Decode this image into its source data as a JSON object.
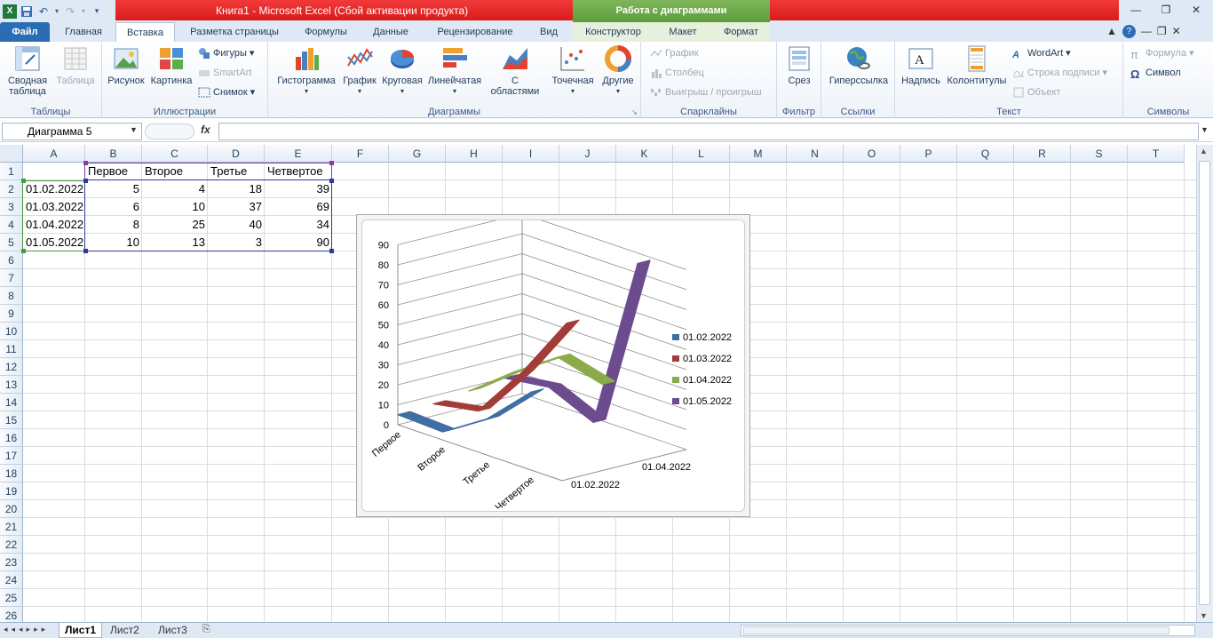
{
  "window": {
    "title": "Книга1  -  Microsoft Excel (Сбой активации продукта)",
    "context_header": "Работа с диаграммами"
  },
  "tabs": [
    "Файл",
    "Главная",
    "Вставка",
    "Разметка страницы",
    "Формулы",
    "Данные",
    "Рецензирование",
    "Вид",
    "Конструктор",
    "Макет",
    "Формат"
  ],
  "ribbon": {
    "tables": {
      "label": "Таблицы",
      "pivot": "Сводная\nтаблица",
      "table": "Таблица"
    },
    "illustrations": {
      "label": "Иллюстрации",
      "picture": "Рисунок",
      "clipart": "Картинка",
      "shapes": "Фигуры",
      "smartart": "SmartArt",
      "screenshot": "Снимок"
    },
    "charts": {
      "label": "Диаграммы",
      "column": "Гистограмма",
      "line": "График",
      "pie": "Круговая",
      "bar": "Линейчатая",
      "area": "С\nобластями",
      "scatter": "Точечная",
      "other": "Другие"
    },
    "sparklines": {
      "label": "Спарклайны",
      "line": "График",
      "column": "Столбец",
      "winloss": "Выигрыш / проигрыш"
    },
    "filter": {
      "label": "Фильтр",
      "slicer": "Срез"
    },
    "links": {
      "label": "Ссылки",
      "hyperlink": "Гиперссылка"
    },
    "text": {
      "label": "Текст",
      "textbox": "Надпись",
      "headerfooter": "Колонтитулы",
      "wordart": "WordArt",
      "signature": "Строка подписи",
      "object": "Объект"
    },
    "symbols": {
      "label": "Символы",
      "equation": "Формула",
      "symbol": "Символ"
    }
  },
  "formula_bar": {
    "name_box": "Диаграмма 5",
    "fx": "fx",
    "formula": ""
  },
  "columns": [
    "A",
    "B",
    "C",
    "D",
    "E",
    "F",
    "G",
    "H",
    "I",
    "J",
    "K",
    "L",
    "M",
    "N",
    "O",
    "P",
    "Q",
    "R",
    "S",
    "T"
  ],
  "rows": [
    "1",
    "2",
    "3",
    "4",
    "5",
    "6",
    "7",
    "8",
    "9",
    "10",
    "11",
    "12",
    "13",
    "14",
    "15",
    "16",
    "17",
    "18",
    "19",
    "20",
    "21",
    "22",
    "23",
    "24",
    "25",
    "26"
  ],
  "table": {
    "headers": [
      "",
      "Первое",
      "Второе",
      "Третье",
      "Четвертое"
    ],
    "rows": [
      [
        "01.02.2022",
        "5",
        "4",
        "18",
        "39"
      ],
      [
        "01.03.2022",
        "6",
        "10",
        "37",
        "69"
      ],
      [
        "01.04.2022",
        "8",
        "25",
        "40",
        "34"
      ],
      [
        "01.05.2022",
        "10",
        "13",
        "3",
        "90"
      ]
    ]
  },
  "chart_data": {
    "type": "line",
    "subtype": "3d-line",
    "categories": [
      "Первое",
      "Второе",
      "Третье",
      "Четвертое"
    ],
    "series": [
      {
        "name": "01.02.2022",
        "values": [
          5,
          4,
          18,
          39
        ],
        "color": "#3e6ea3"
      },
      {
        "name": "01.03.2022",
        "values": [
          6,
          10,
          37,
          69
        ],
        "color": "#a33c39"
      },
      {
        "name": "01.04.2022",
        "values": [
          8,
          25,
          40,
          34
        ],
        "color": "#8bab4a"
      },
      {
        "name": "01.05.2022",
        "values": [
          10,
          13,
          3,
          90
        ],
        "color": "#6c4c8e"
      }
    ],
    "y_ticks": [
      "0",
      "10",
      "20",
      "30",
      "40",
      "50",
      "60",
      "70",
      "80",
      "90"
    ],
    "depth_labels": [
      "01.02.2022",
      "01.04.2022"
    ],
    "ylim": [
      0,
      90
    ],
    "legend_position": "right",
    "grid": true
  },
  "sheets": [
    "Лист1",
    "Лист2",
    "Лист3"
  ]
}
